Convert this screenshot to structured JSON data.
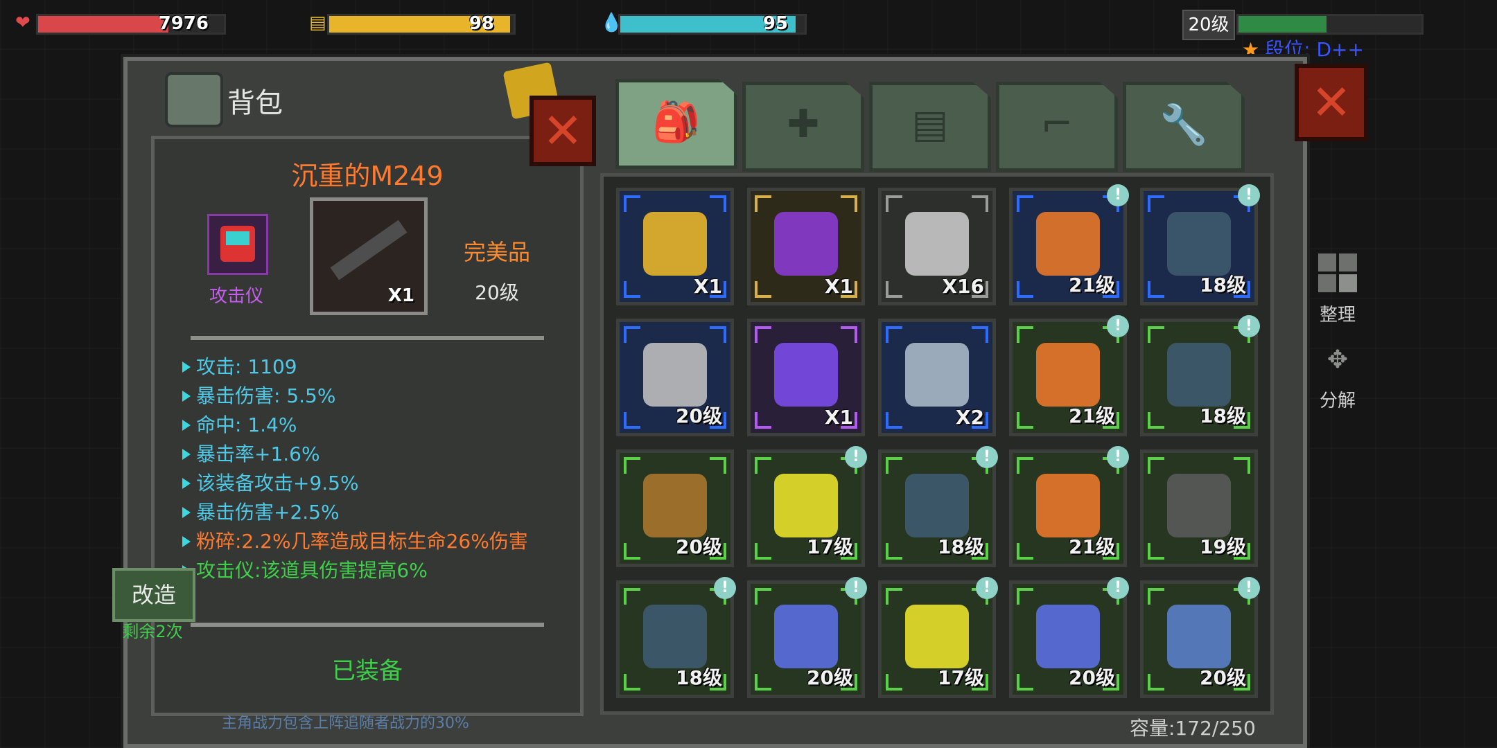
{
  "hud": {
    "health": {
      "value": "7976",
      "fraction": 0.7,
      "color": "#d9474a",
      "icon": "heart-icon"
    },
    "food": {
      "value": "98",
      "fraction": 0.98,
      "color": "#e8b52a",
      "icon": "food-icon"
    },
    "water": {
      "value": "95",
      "fraction": 0.95,
      "color": "#3dbfcc",
      "icon": "water-drop-icon"
    },
    "level": "20级",
    "xp_fraction": 0.48,
    "rank_label": "段位: D++"
  },
  "panel": {
    "title": "背包",
    "capacity": "容量:172/250"
  },
  "detail": {
    "item_name": "沉重的M249",
    "aux_label": "攻击仪",
    "weapon_qty": "X1",
    "quality": "完美品",
    "level": "20级",
    "stats": [
      {
        "text": "攻击: 1109",
        "color": "#4fc9e8"
      },
      {
        "text": "暴击伤害: 5.5%",
        "color": "#4fc9e8"
      },
      {
        "text": "命中: 1.4%",
        "color": "#4fc9e8"
      },
      {
        "text": "暴击率+1.6%",
        "color": "#4fc9e8"
      },
      {
        "text": "该装备攻击+9.5%",
        "color": "#4fc9e8"
      },
      {
        "text": "暴击伤害+2.5%",
        "color": "#4fc9e8"
      },
      {
        "text": "粉碎:2.2%几率造成目标生命26%伤害",
        "color": "#ff7a2e"
      },
      {
        "text": "攻击仪:该道具伤害提高6%",
        "color": "#3fcf4a"
      }
    ],
    "equipped_label": "已装备",
    "modify_button": "改造",
    "remaining": "剩余2次",
    "footnote": "主角战力包含上阵追随者战力的30%"
  },
  "tabs": [
    {
      "name": "backpack",
      "icon": "backpack-icon",
      "glyph": "🎒",
      "active": true
    },
    {
      "name": "medical",
      "icon": "medkit-icon",
      "glyph": "✚",
      "active": false
    },
    {
      "name": "materials",
      "icon": "materials-icon",
      "glyph": "▤",
      "active": false
    },
    {
      "name": "weapons",
      "icon": "gun-icon",
      "glyph": "⌐",
      "active": false
    },
    {
      "name": "tools",
      "icon": "wrench-icon",
      "glyph": "🔧",
      "active": false
    }
  ],
  "inventory": [
    {
      "label": "X1",
      "rarity": "blue",
      "icon": "supply-crate-icon",
      "art": "#e8b52a",
      "badge": false
    },
    {
      "label": "X1",
      "rarity": "gold",
      "icon": "purple-robot-box-icon",
      "art": "#8a3ad0",
      "badge": false
    },
    {
      "label": "X16",
      "rarity": "gray",
      "icon": "metal-crate-icon",
      "art": "#c8c8c8",
      "badge": false
    },
    {
      "label": "21级",
      "rarity": "blue",
      "icon": "orange-jacket-icon",
      "art": "#e8772a",
      "badge": true
    },
    {
      "label": "18级",
      "rarity": "blue",
      "icon": "cap-icon",
      "art": "#3e5a6e",
      "badge": true
    },
    {
      "label": "20级",
      "rarity": "blue",
      "icon": "machete-icon",
      "art": "#bcbcbc",
      "badge": false
    },
    {
      "label": "X1",
      "rarity": "purple",
      "icon": "purple-crystal-icon",
      "art": "#7a4bea",
      "badge": false
    },
    {
      "label": "X2",
      "rarity": "blue",
      "icon": "map-icon",
      "art": "#a9b8c8",
      "badge": false
    },
    {
      "label": "21级",
      "rarity": "green",
      "icon": "orange-jacket-icon",
      "art": "#e8772a",
      "badge": true
    },
    {
      "label": "18级",
      "rarity": "green",
      "icon": "cap-icon",
      "art": "#3e5a6e",
      "badge": true
    },
    {
      "label": "20级",
      "rarity": "green",
      "icon": "baseball-bat-icon",
      "art": "#a8742e",
      "badge": false
    },
    {
      "label": "17级",
      "rarity": "green",
      "icon": "taser-gun-icon",
      "art": "#e8e02a",
      "badge": true
    },
    {
      "label": "18级",
      "rarity": "green",
      "icon": "cap-icon",
      "art": "#3e5a6e",
      "badge": true
    },
    {
      "label": "21级",
      "rarity": "green",
      "icon": "orange-jacket-icon",
      "art": "#e8772a",
      "badge": true
    },
    {
      "label": "19级",
      "rarity": "green",
      "icon": "crossbow-icon",
      "art": "#5a5a5a",
      "badge": false
    },
    {
      "label": "18级",
      "rarity": "green",
      "icon": "cap-icon",
      "art": "#3e5a6e",
      "badge": true
    },
    {
      "label": "20级",
      "rarity": "green",
      "icon": "blue-helmet-icon",
      "art": "#5a6ee0",
      "badge": true
    },
    {
      "label": "17级",
      "rarity": "green",
      "icon": "taser-gun-icon",
      "art": "#e8e02a",
      "badge": true
    },
    {
      "label": "20级",
      "rarity": "green",
      "icon": "blue-helmet-icon",
      "art": "#5a6ee0",
      "badge": true
    },
    {
      "label": "20级",
      "rarity": "green",
      "icon": "jeans-icon",
      "art": "#5a7ec8",
      "badge": true
    }
  ],
  "side": {
    "sort_label": "整理",
    "dismantle_label": "分解"
  }
}
